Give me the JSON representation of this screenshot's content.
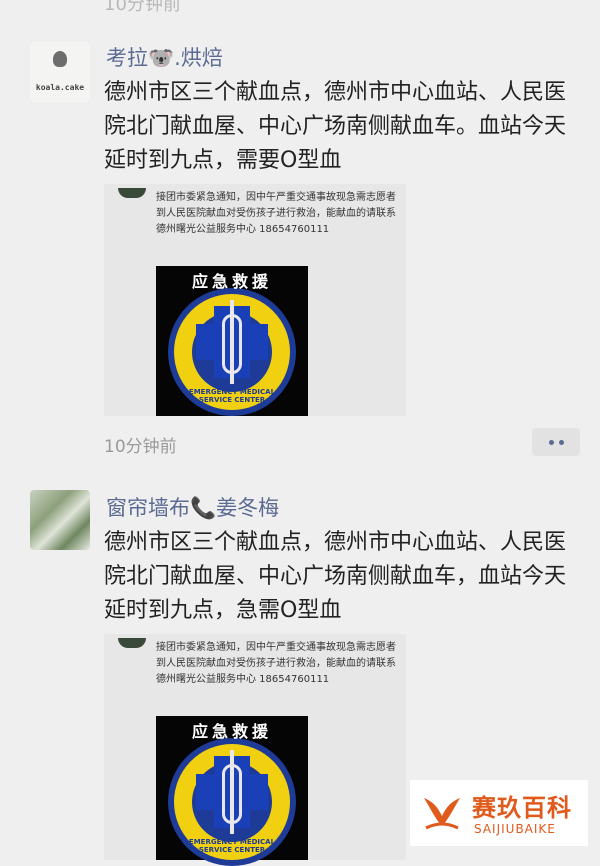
{
  "top_time": "10分钟前",
  "posts": [
    {
      "author": "考拉🐨.烘焙",
      "avatar_text": "koala.cake",
      "content": "德州市区三个献血点，德州市中心血站、人民医院北门献血屋、中心广场南侧献血车。血站今天延时到九点，需要O型血",
      "share_text": "接团市委紧急通知，因中午严重交通事故现急需志愿者到人民医院献血对受伤孩子进行救治，能献血的请联系德州曙光公益服务中心 18654760111",
      "image_title": "应急救援",
      "image_ring_text": "EMERGENCY MEDICAL SERVICE CENTER",
      "time": "10分钟前"
    },
    {
      "author": "窗帘墙布📞姜冬梅",
      "content": "德州市区三个献血点，德州市中心血站、人民医院北门献血屋、中心广场南侧献血车，血站今天延时到九点，急需O型血",
      "share_text": "接团市委紧急通知，因中午严重交通事故现急需志愿者到人民医院献血对受伤孩子进行救治，能献血的请联系德州曙光公益服务中心 18654760111",
      "image_title": "应急救援",
      "image_ring_text": "EMERGENCY MEDICAL SERVICE CENTER"
    }
  ],
  "watermark": {
    "brand_cn": "赛玖百科",
    "brand_en": "SAIJIUBAIKE"
  },
  "colors": {
    "name": "#5b6b92",
    "ems_blue": "#1d3b97",
    "ems_yellow": "#f0d010",
    "brand": "#e05a1c"
  }
}
